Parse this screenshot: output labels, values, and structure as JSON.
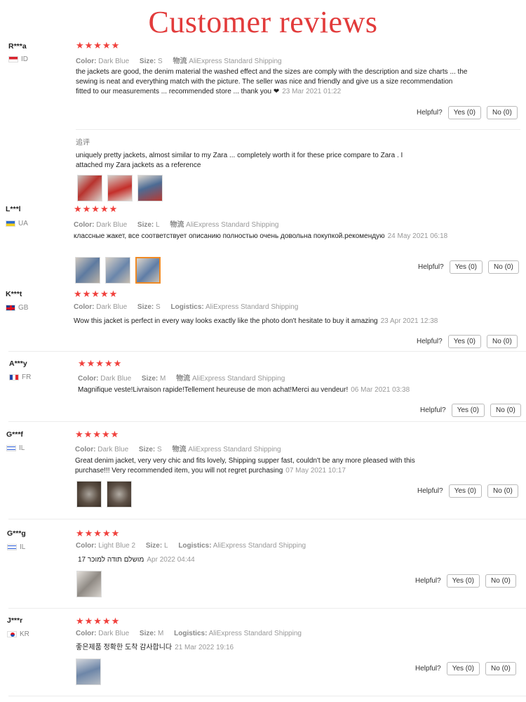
{
  "page_title": "Customer reviews",
  "labels": {
    "color": "Color:",
    "size": "Size:",
    "logistics_cn": "物流",
    "logistics_en": "Logistics:",
    "helpful": "Helpful?",
    "yes": "Yes (0)",
    "no": "No (0)",
    "stars": "★★★★★",
    "appended_label": "追评"
  },
  "colors": {
    "accent": "#e23b3b",
    "stars": "#f0403c",
    "selected_thumb": "#f08a24"
  },
  "reviews": [
    {
      "user": "R***a",
      "country": "ID",
      "color": "Dark Blue",
      "size": "S",
      "shipping": "AliExpress Standard Shipping",
      "text": "the jackets are good, the denim material the washed effect and the sizes are comply with the description and size charts ... the sewing is neat and everything match with the picture. The seller was nice and friendly and give us a size recommendation fitted to our measurements ... recommended store ... thank you",
      "heart": "❤",
      "date": "23 Mar 2021 01:22",
      "followup_text": "uniquely pretty jackets, almost similar to my Zara ... completely worth it for these price compare to Zara . I attached my Zara jackets as a reference"
    },
    {
      "user": "L***l",
      "country": "UA",
      "color": "Dark Blue",
      "size": "L",
      "shipping": "AliExpress Standard Shipping",
      "text": "классные жакет, все соответствует описанию полностью очень довольна покупкой.рекомендую",
      "date": "24 May 2021 06:18"
    },
    {
      "user": "K***t",
      "country": "GB",
      "color": "Dark Blue",
      "size": "S",
      "shipping": "AliExpress Standard Shipping",
      "text": "Wow this jacket is perfect in every way looks exactly like the photo don't hesitate to buy it amazing",
      "date": "23 Apr 2021 12:38"
    },
    {
      "user": "A***y",
      "country": "FR",
      "color": "Dark Blue",
      "size": "M",
      "shipping": "AliExpress Standard Shipping",
      "text": "Magnifique veste!Livraison rapide!Tellement heureuse de mon achat!Merci au vendeur!",
      "date": "06 Mar 2021 03:38"
    },
    {
      "user": "G***f",
      "country": "IL",
      "color": "Dark Blue",
      "size": "S",
      "shipping": "AliExpress Standard Shipping",
      "text": "Great denim jacket, very very chic and fits lovely, Shipping supper fast, couldn't be any more pleased with this purchase!!! Very recommended item, you will not regret purchasing",
      "date": "07 May 2021 10:17"
    },
    {
      "user": "G***g",
      "country": "IL",
      "color": "Light Blue 2",
      "size": "L",
      "shipping": "AliExpress Standard Shipping",
      "text": "17 מושלם תודה למוכר",
      "date": "Apr 2022 04:44"
    },
    {
      "user": "J***r",
      "country": "KR",
      "color": "Dark Blue",
      "size": "M",
      "shipping": "AliExpress Standard Shipping",
      "text": "좋은제품 정확한 도착 감사합니다",
      "date": "21 Mar 2022 19:16"
    }
  ]
}
